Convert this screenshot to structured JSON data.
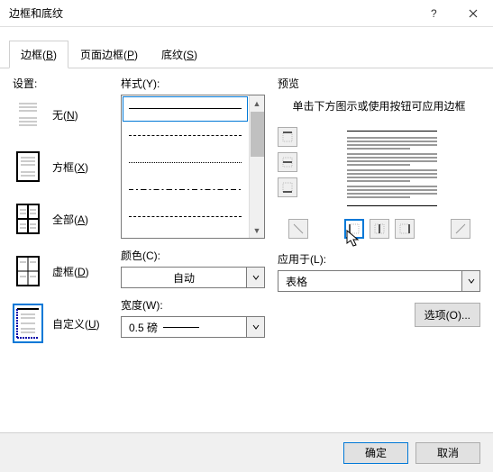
{
  "window": {
    "title": "边框和底纹"
  },
  "tabs": {
    "border": {
      "label": "边框(",
      "accel": "B",
      "suffix": ")"
    },
    "page_border": {
      "label": "页面边框(",
      "accel": "P",
      "suffix": ")"
    },
    "shading": {
      "label": "底纹(",
      "accel": "S",
      "suffix": ")"
    }
  },
  "settings": {
    "label": "设置:",
    "none": {
      "label": "无(",
      "accel": "N",
      "suffix": ")"
    },
    "box": {
      "label": "方框(",
      "accel": "X",
      "suffix": ")"
    },
    "all": {
      "label": "全部(",
      "accel": "A",
      "suffix": ")"
    },
    "grid": {
      "label": "虚框(",
      "accel": "D",
      "suffix": ")"
    },
    "custom": {
      "label": "自定义(",
      "accel": "U",
      "suffix": ")"
    }
  },
  "style": {
    "label": "样式(",
    "accel": "Y",
    "suffix": "):"
  },
  "color": {
    "label_pre": "颜色(",
    "accel": "C",
    "suffix": "):",
    "value": "自动"
  },
  "width": {
    "label_pre": "宽度(",
    "accel": "W",
    "suffix": "):",
    "value": "0.5 磅"
  },
  "preview": {
    "label": "预览",
    "hint": "单击下方图示或使用按钮可应用边框"
  },
  "apply": {
    "label_pre": "应用于(",
    "accel": "L",
    "suffix": "):",
    "value": "表格"
  },
  "buttons": {
    "options": "选项(O)...",
    "ok": "确定",
    "cancel": "取消"
  }
}
